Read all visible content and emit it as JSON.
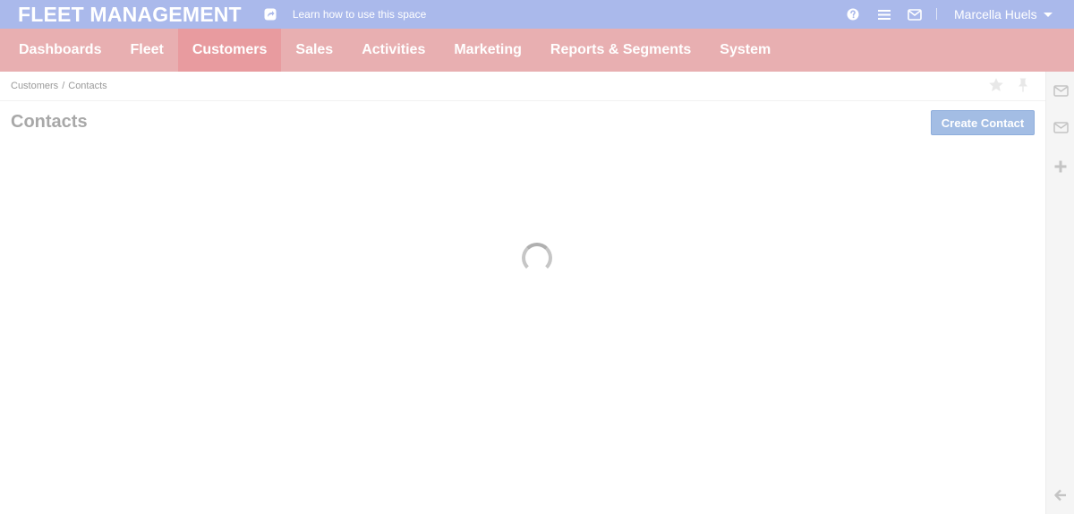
{
  "app": {
    "title": "FLEET MANAGEMENT",
    "learn_link": "Learn how to use this space"
  },
  "header": {
    "user_name": "Marcella Huels",
    "icons": [
      "share-icon",
      "help-icon",
      "list-icon",
      "mail-icon",
      "caret-down-icon"
    ]
  },
  "nav": {
    "items": [
      {
        "label": "Dashboards"
      },
      {
        "label": "Fleet"
      },
      {
        "label": "Customers",
        "active": true
      },
      {
        "label": "Sales"
      },
      {
        "label": "Activities"
      },
      {
        "label": "Marketing"
      },
      {
        "label": "Reports & Segments"
      },
      {
        "label": "System"
      }
    ]
  },
  "breadcrumb": {
    "parent": "Customers",
    "separator": "/",
    "current": "Contacts"
  },
  "page": {
    "title": "Contacts",
    "create_button": "Create Contact",
    "loading": true
  },
  "sidebar_right": {
    "icons": [
      "mail-icon",
      "mail-icon",
      "plus-icon",
      "arrow-left-icon"
    ]
  },
  "colors": {
    "topbar": "#aab9eb",
    "navbar": "#e8afb1",
    "nav_active": "#e89b9f",
    "button": "#a3bde4",
    "sidebar": "#f5f5f5"
  }
}
